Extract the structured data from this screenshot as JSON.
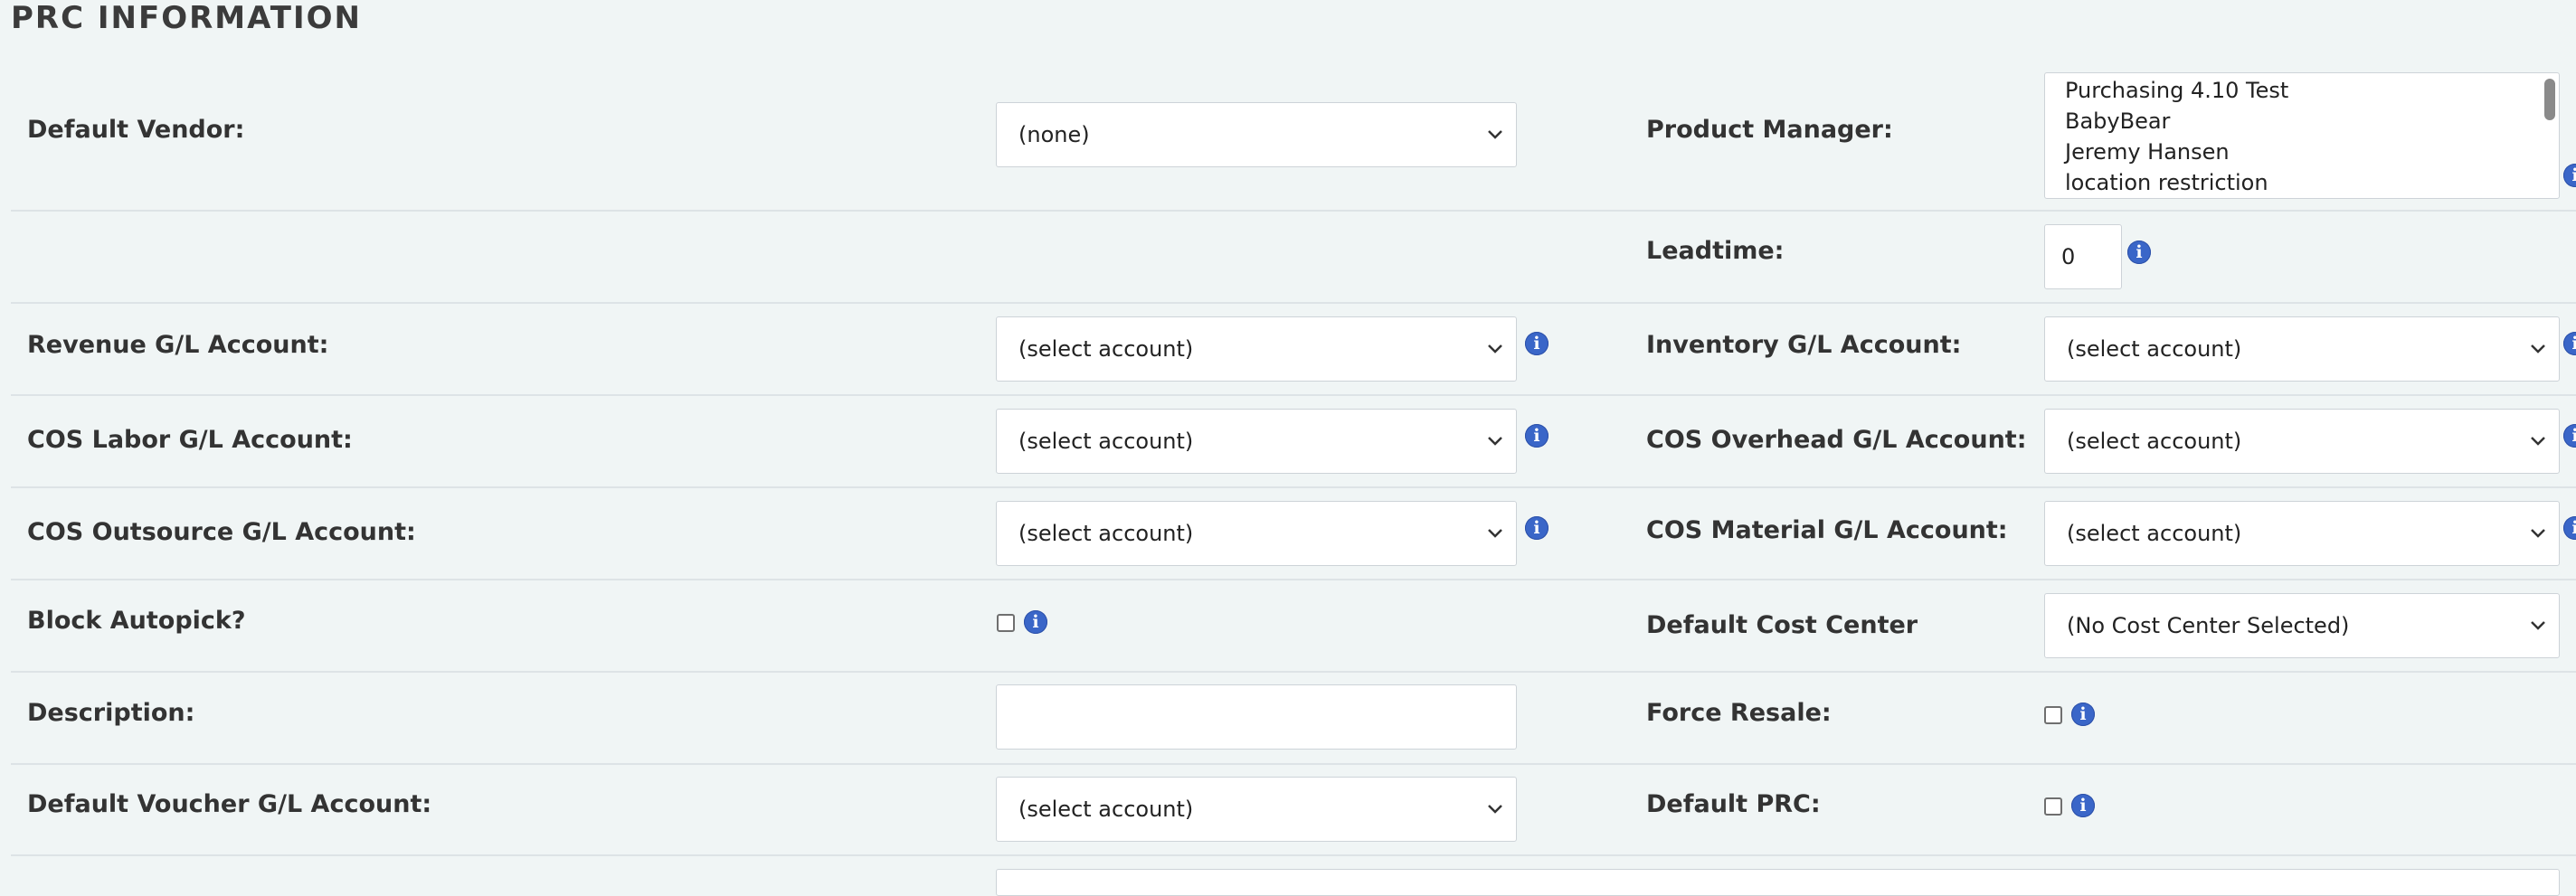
{
  "section_title": "PRC INFORMATION",
  "left": {
    "default_vendor": {
      "label": "Default Vendor:",
      "value": "(none)"
    },
    "revenue_gl": {
      "label": "Revenue G/L Account:",
      "value": "(select account)"
    },
    "cos_labor_gl": {
      "label": "COS Labor G/L Account:",
      "value": "(select account)"
    },
    "cos_outsource_gl": {
      "label": "COS Outsource G/L Account:",
      "value": "(select account)"
    },
    "block_autopick": {
      "label": "Block Autopick?",
      "checked": false
    },
    "description": {
      "label": "Description:",
      "value": ""
    },
    "default_voucher_gl": {
      "label": "Default Voucher G/L Account:",
      "value": "(select account)"
    }
  },
  "right": {
    "product_manager": {
      "label": "Product Manager:",
      "options": [
        "Purchasing 4.10 Test",
        "BabyBear",
        "Jeremy Hansen",
        "location restriction"
      ]
    },
    "leadtime": {
      "label": "Leadtime:",
      "value": "0"
    },
    "inventory_gl": {
      "label": "Inventory G/L Account:",
      "value": "(select account)"
    },
    "cos_overhead_gl": {
      "label": "COS Overhead G/L Account:",
      "value": "(select account)"
    },
    "cos_material_gl": {
      "label": "COS Material G/L Account:",
      "value": "(select account)"
    },
    "default_cost_center": {
      "label": "Default Cost Center",
      "value": "(No Cost Center Selected)"
    },
    "force_resale": {
      "label": "Force Resale:",
      "checked": false
    },
    "default_prc": {
      "label": "Default PRC:",
      "checked": false
    }
  },
  "icons": {
    "info": "i",
    "info_color": "#3a66c8"
  }
}
